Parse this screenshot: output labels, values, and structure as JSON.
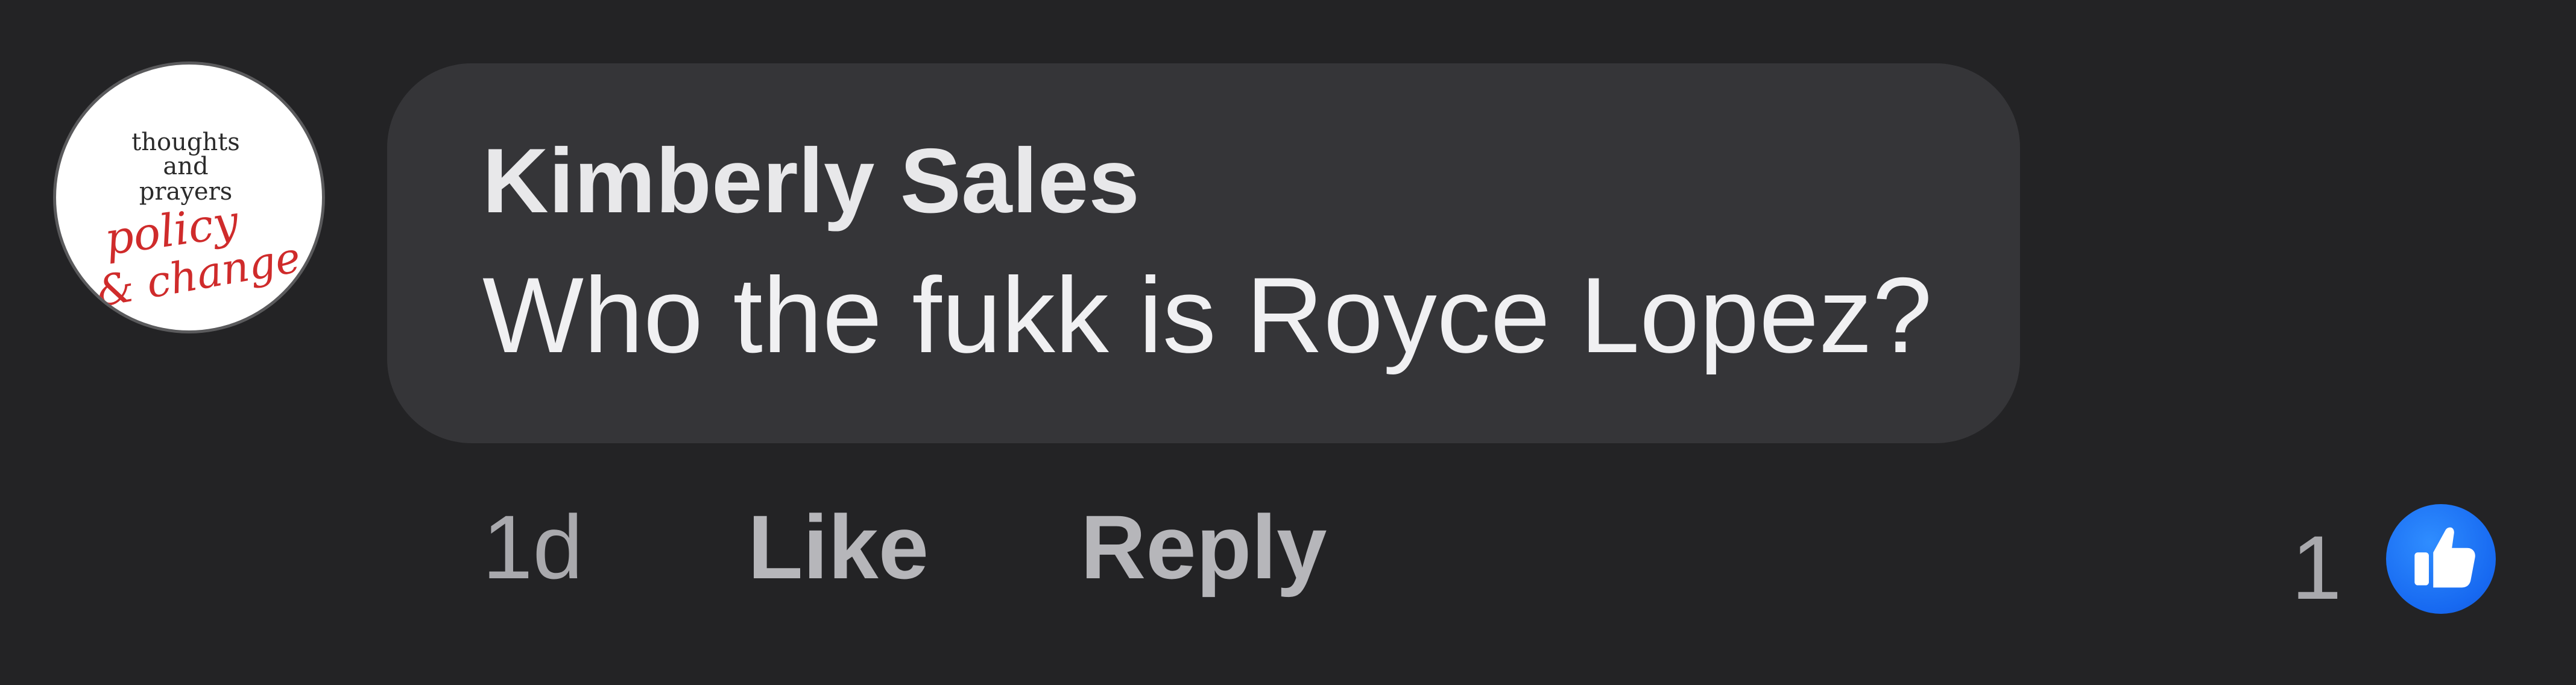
{
  "comment": {
    "avatar": {
      "line1": "thoughts",
      "line2": "and",
      "line3": "prayers",
      "script1": "policy",
      "script2": "& change"
    },
    "author": "Kimberly Sales",
    "text": "Who the fukk is Royce Lopez?"
  },
  "actions": {
    "timestamp": "1d",
    "like_label": "Like",
    "reply_label": "Reply"
  },
  "reactions": {
    "count": "1",
    "icon": "thumbs-up-icon",
    "icon_color": "#1877F2"
  }
}
